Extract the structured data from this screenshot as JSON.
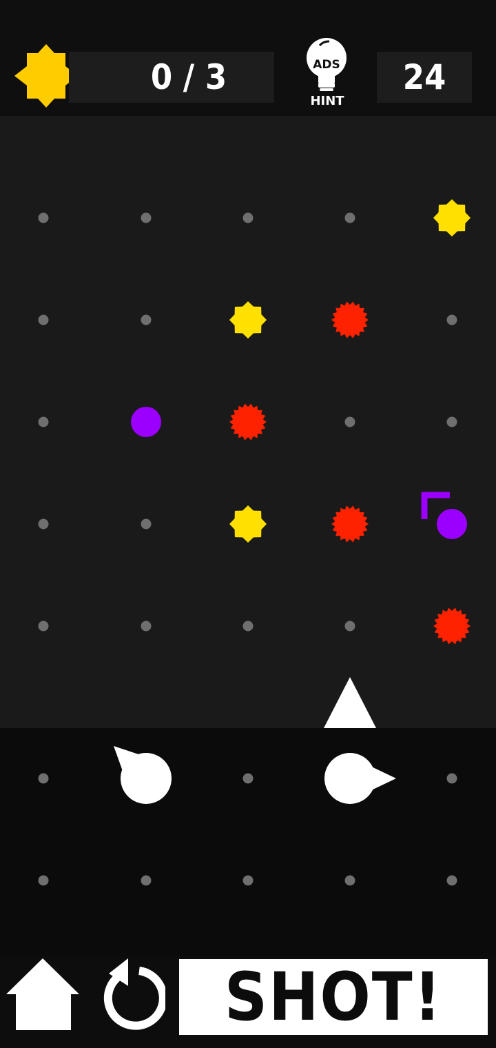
{
  "header": {
    "stars_collected_text": "0 / 3",
    "moves_left": "24",
    "hint_label": "HINT",
    "hint_ads_label": "ADS",
    "star_color": "#FFCC00"
  },
  "board": {
    "rows": 5,
    "cols": 5,
    "grid_dot_color": "#6f6f6f",
    "pieces": [
      {
        "type": "yellow-star",
        "row": 1,
        "col": 5
      },
      {
        "type": "yellow-star",
        "row": 2,
        "col": 3
      },
      {
        "type": "red-burst",
        "row": 2,
        "col": 4
      },
      {
        "type": "purple-ball",
        "row": 3,
        "col": 2
      },
      {
        "type": "red-burst",
        "row": 3,
        "col": 3
      },
      {
        "type": "yellow-star",
        "row": 4,
        "col": 3
      },
      {
        "type": "red-burst",
        "row": 4,
        "col": 4
      },
      {
        "type": "purple-target",
        "row": 4,
        "col": 5
      },
      {
        "type": "red-burst",
        "row": 5,
        "col": 5
      }
    ],
    "launcher": {
      "col": 4,
      "direction": "up"
    },
    "colors": {
      "yellow": "#FFE000",
      "red": "#FF2200",
      "purple": "#9B00FF",
      "white": "#FFFFFF"
    }
  },
  "tray": {
    "rows": 2,
    "cols": 5,
    "pieces": [
      {
        "type": "deflector",
        "row": 1,
        "col": 2,
        "pointer": "up-left"
      },
      {
        "type": "deflector",
        "row": 1,
        "col": 4,
        "pointer": "right"
      }
    ]
  },
  "controls": {
    "shot_label": "SHOT!"
  }
}
